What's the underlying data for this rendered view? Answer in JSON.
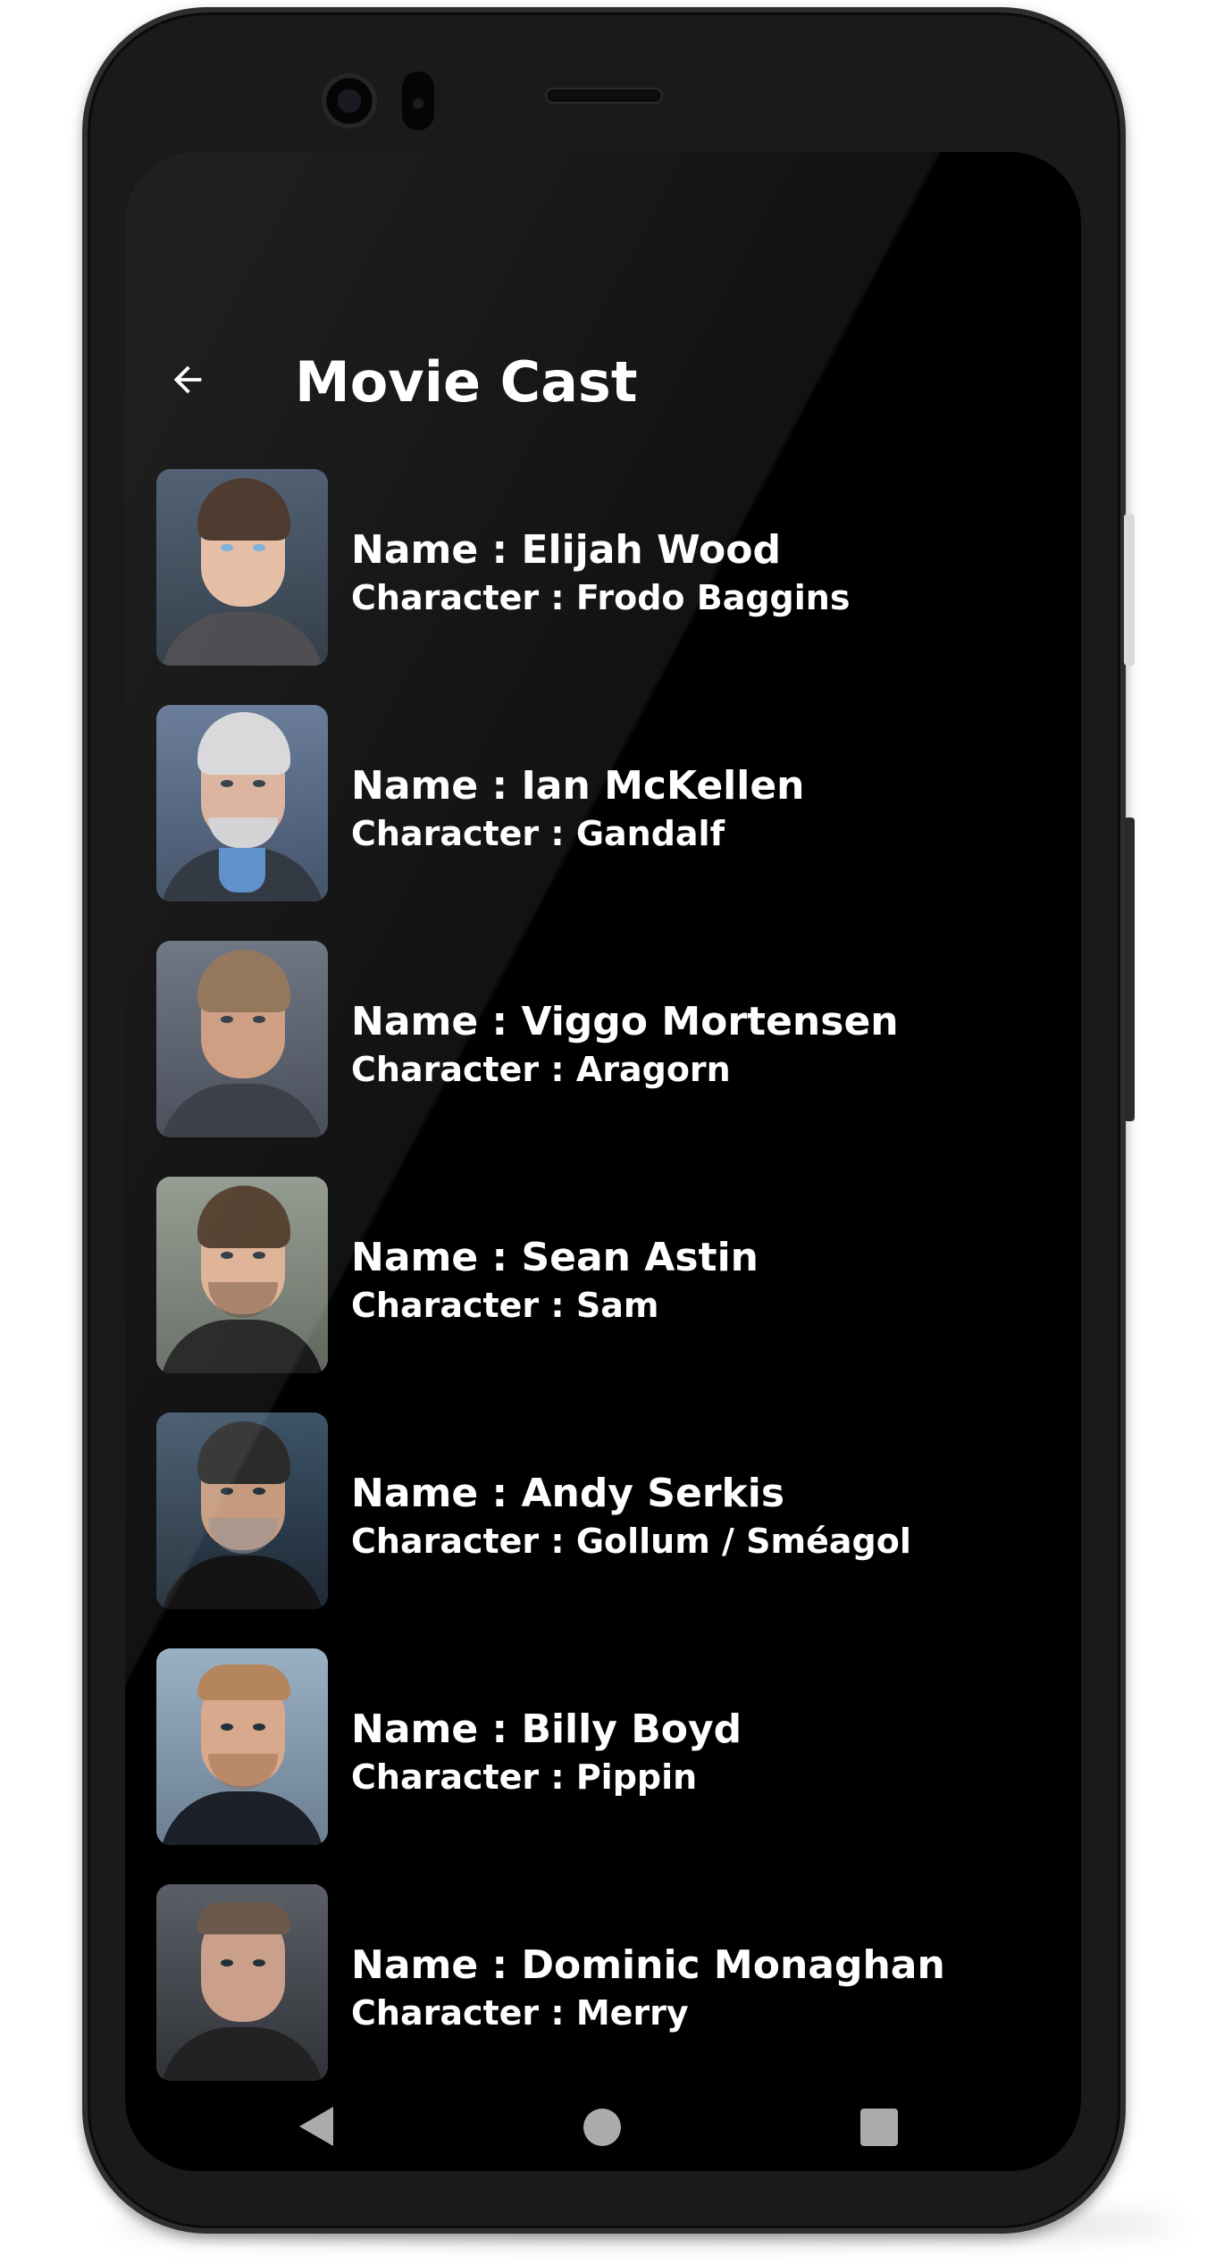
{
  "app_bar": {
    "title": "Movie Cast",
    "back_icon": "arrow-left-icon"
  },
  "cast": [
    {
      "name": "Name : Elijah Wood",
      "character": "Character : Frodo Baggins",
      "photo": "elijah-wood-portrait"
    },
    {
      "name": "Name : Ian McKellen",
      "character": "Character : Gandalf",
      "photo": "ian-mckellen-portrait"
    },
    {
      "name": "Name : Viggo Mortensen",
      "character": "Character : Aragorn",
      "photo": "viggo-mortensen-portrait"
    },
    {
      "name": "Name : Sean Astin",
      "character": "Character : Sam",
      "photo": "sean-astin-portrait"
    },
    {
      "name": "Name : Andy Serkis",
      "character": "Character : Gollum / Sméagol",
      "photo": "andy-serkis-portrait"
    },
    {
      "name": "Name : Billy Boyd",
      "character": "Character : Pippin",
      "photo": "billy-boyd-portrait"
    },
    {
      "name": "Name : Dominic Monaghan",
      "character": "Character : Merry",
      "photo": "dominic-monaghan-portrait"
    }
  ],
  "nav_bar": {
    "back_icon": "triangle-back-icon",
    "home_icon": "circle-home-icon",
    "recents_icon": "square-recents-icon"
  },
  "colors": {
    "screen_background": "#000000",
    "text": "#ffffff",
    "nav_icons": "#ababab",
    "phone_frame": "#1a1a1a"
  }
}
